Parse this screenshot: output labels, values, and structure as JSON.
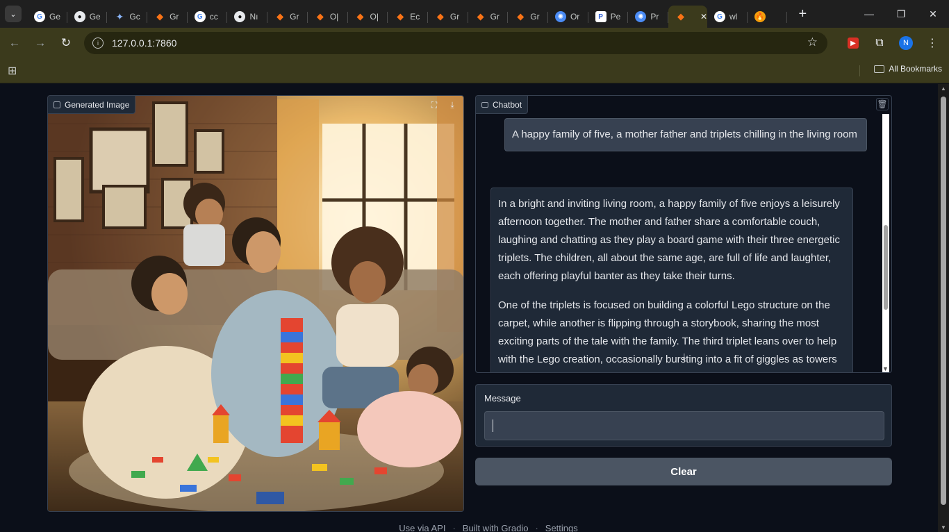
{
  "browser": {
    "tabs": [
      {
        "icon": "google",
        "label": "Ge"
      },
      {
        "icon": "github",
        "label": "Ge"
      },
      {
        "icon": "gemini",
        "label": "Gc"
      },
      {
        "icon": "gradio",
        "label": "Gr"
      },
      {
        "icon": "google",
        "label": "cc"
      },
      {
        "icon": "github",
        "label": "Nı"
      },
      {
        "icon": "gradio",
        "label": "Gr"
      },
      {
        "icon": "gradio",
        "label": "O|"
      },
      {
        "icon": "gradio",
        "label": "O|"
      },
      {
        "icon": "gradio",
        "label": "Ec"
      },
      {
        "icon": "gradio",
        "label": "Gr"
      },
      {
        "icon": "gradio",
        "label": "Gr"
      },
      {
        "icon": "gradio",
        "label": "Gr"
      },
      {
        "icon": "openai",
        "label": "Or"
      },
      {
        "icon": "pe",
        "label": "Pe"
      },
      {
        "icon": "openai",
        "label": "Pr"
      },
      {
        "icon": "gradio",
        "label": "",
        "active": true
      },
      {
        "icon": "google",
        "label": "wl"
      },
      {
        "icon": "fire",
        "label": ""
      }
    ],
    "url": "127.0.0.1:7860",
    "profile_initial": "N",
    "all_bookmarks": "All Bookmarks"
  },
  "image_panel": {
    "label": "Generated Image"
  },
  "chatbot": {
    "label": "Chatbot",
    "user_message": "A happy family of five, a mother father and triplets chilling in the living room",
    "bot_paragraphs": [
      "In a bright and inviting living room, a happy family of five enjoys a leisurely afternoon together. The mother and father share a comfortable couch, laughing and chatting as they play a board game with their three energetic triplets. The children, all about the same age, are full of life and laughter, each offering playful banter as they take their turns.",
      "One of the triplets is focused on building a colorful Lego structure on the carpet, while another is flipping through a storybook, sharing the most exciting parts of the tale with the family. The third triplet leans over to help with the Lego creation, occasionally bursting into a fit of giggles as towers wobble and fall."
    ]
  },
  "message": {
    "label": "Message",
    "value": ""
  },
  "clear_button": "Clear",
  "footer": {
    "api": "Use via API",
    "built": "Built with Gradio",
    "settings": "Settings"
  }
}
